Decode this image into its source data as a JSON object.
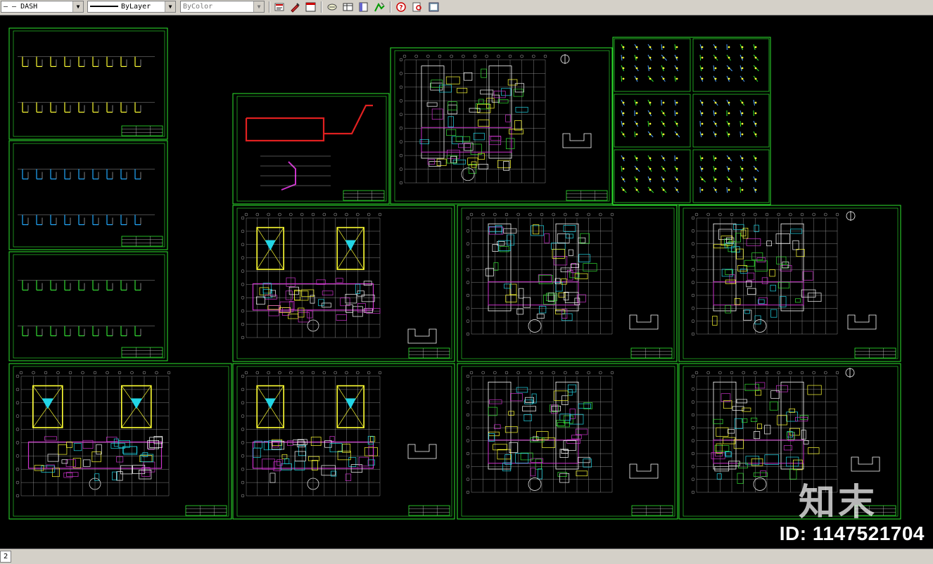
{
  "toolbar": {
    "linetype": {
      "value": "DASH",
      "preview": "— —"
    },
    "lineweight": {
      "value": "ByLayer"
    },
    "color": {
      "value": "ByColor"
    }
  },
  "layout_tab": {
    "label": "2"
  },
  "watermark": {
    "id_text": "ID: 1147521704",
    "logo_text": "知末"
  },
  "colors": {
    "sheet_border": "#2ee62e",
    "floorplan_yellow": "#ffff33",
    "floorplan_cyan": "#22d6e6",
    "floorplan_magenta": "#cc33cc",
    "pipe_red": "#e02020",
    "background": "#000000",
    "ui_gray": "#d4d0c8"
  },
  "toolbar_icons": [
    "properties-icon",
    "match-properties-icon",
    "layer-icon",
    "layout-icon",
    "view-icon",
    "table-icon",
    "tool-palette-icon",
    "help-icon",
    "search-help-icon",
    "settings-icon"
  ]
}
